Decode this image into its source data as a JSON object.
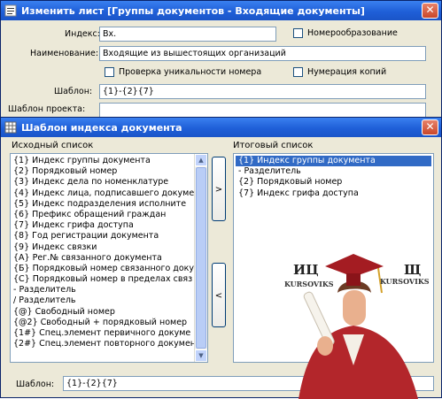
{
  "back_window": {
    "title": "Изменить лист [Группы документов - Входящие документы]",
    "index_label": "Индекс:",
    "index_value": "Вх.",
    "numbering_label": "Номерообразование",
    "name_label": "Наименование:",
    "name_value": "Входящие из вышестоящих организаций",
    "uniqueness_label": "Проверка уникальности номера",
    "copy_numbering_label": "Нумерация копий",
    "template_label": "Шаблон:",
    "template_value": "{1}-{2}{7}",
    "project_template_label": "Шаблон проекта:"
  },
  "dialog": {
    "title": "Шаблон индекса документа",
    "source_list_label": "Исходный список",
    "result_list_label": "Итоговый список",
    "source_items": [
      "{1}  Индекс группы документа",
      "{2}  Порядковый номер",
      "{3}  Индекс дела по номенклатуре",
      "{4}  Индекс лица, подписавшего докуме",
      "{5}  Индекс подразделения исполните",
      "{6}  Префикс обращений граждан",
      "{7}  Индекс грифа доступа",
      "{8}  Год регистрации документа",
      "{9}  Индекс связки",
      "{A}  Рег.№ связанного документа",
      "{Б}  Порядковый номер связанного доку",
      "{С}  Порядковый номер в пределах связ",
      "-    Разделитель",
      "/    Разделитель",
      "{@}  Свободный номер",
      "{@2}  Свободный + порядковый номер",
      "{1#}  Спец.элемент первичного докумe",
      "{2#}  Спец.элемент повторного докумен"
    ],
    "result_items": [
      "{1}  Индекс группы документа",
      "-    Разделитель",
      "{2}  Порядковый номер",
      "{7}  Индекс грифа доступа"
    ],
    "add_button": ">",
    "remove_button": "<",
    "template_label": "Шаблон:",
    "template_value": "{1}-{2}{7}"
  },
  "watermark": {
    "left_text": "ИЦ",
    "left_sub": "KURSOVIKS",
    "right_text": "Щ",
    "right_sub": "KURSOVIKS"
  },
  "colors": {
    "titlebar": "#2563d9",
    "window_bg": "#ece9d8",
    "selection": "#316ac5",
    "close_button": "#d65c3e"
  }
}
